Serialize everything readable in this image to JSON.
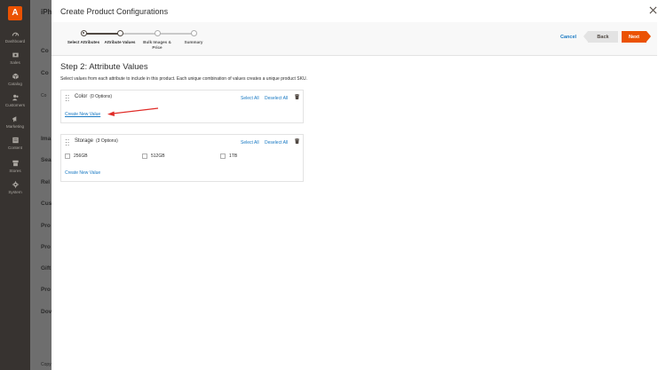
{
  "sidebar": {
    "logo_letter": "A",
    "items": [
      {
        "label": "Dashboard",
        "icon": "dashboard-icon"
      },
      {
        "label": "Sales",
        "icon": "dollar-icon"
      },
      {
        "label": "Catalog",
        "icon": "box-icon"
      },
      {
        "label": "Customers",
        "icon": "customers-icon"
      },
      {
        "label": "Marketing",
        "icon": "megaphone-icon"
      },
      {
        "label": "Content",
        "icon": "content-icon"
      },
      {
        "label": "Stores",
        "icon": "store-icon"
      },
      {
        "label": "System",
        "icon": "gear-icon"
      }
    ]
  },
  "background_page": {
    "title": "iPh",
    "sections": [
      "Co",
      "Co",
      "Co",
      "Ima",
      "Sea",
      "Rel",
      "Cus",
      "Pro",
      "Pro",
      "Gift",
      "Pro",
      "Dov"
    ],
    "footer": "Copy"
  },
  "modal": {
    "title": "Create Product Configurations",
    "wizard": {
      "steps": [
        {
          "label": "Select Attributes",
          "state": "done"
        },
        {
          "label": "Attribute Values",
          "state": "active"
        },
        {
          "label": "Bulk Images & Price",
          "state": "pending"
        },
        {
          "label": "Summary",
          "state": "pending"
        }
      ],
      "cancel_label": "Cancel",
      "back_label": "Back",
      "next_label": "Next"
    },
    "step_heading": "Step 2: Attribute Values",
    "step_description": "Select values from each attribute to include in this product. Each unique combination of values creates a unique product SKU.",
    "attributes": [
      {
        "name": "Color",
        "count": "(0 Options)",
        "select_all": "Select All",
        "deselect_all": "Deselect All",
        "options": [],
        "create_label": "Create New Value"
      },
      {
        "name": "Storage",
        "count": "(3 Options)",
        "select_all": "Select All",
        "deselect_all": "Deselect All",
        "options": [
          "256GB",
          "512GB",
          "1TB"
        ],
        "create_label": "Create New Value"
      }
    ]
  },
  "colors": {
    "accent": "#eb5202",
    "link": "#1979c3",
    "sidebar": "#373330",
    "annotation_arrow": "#e02b27"
  }
}
